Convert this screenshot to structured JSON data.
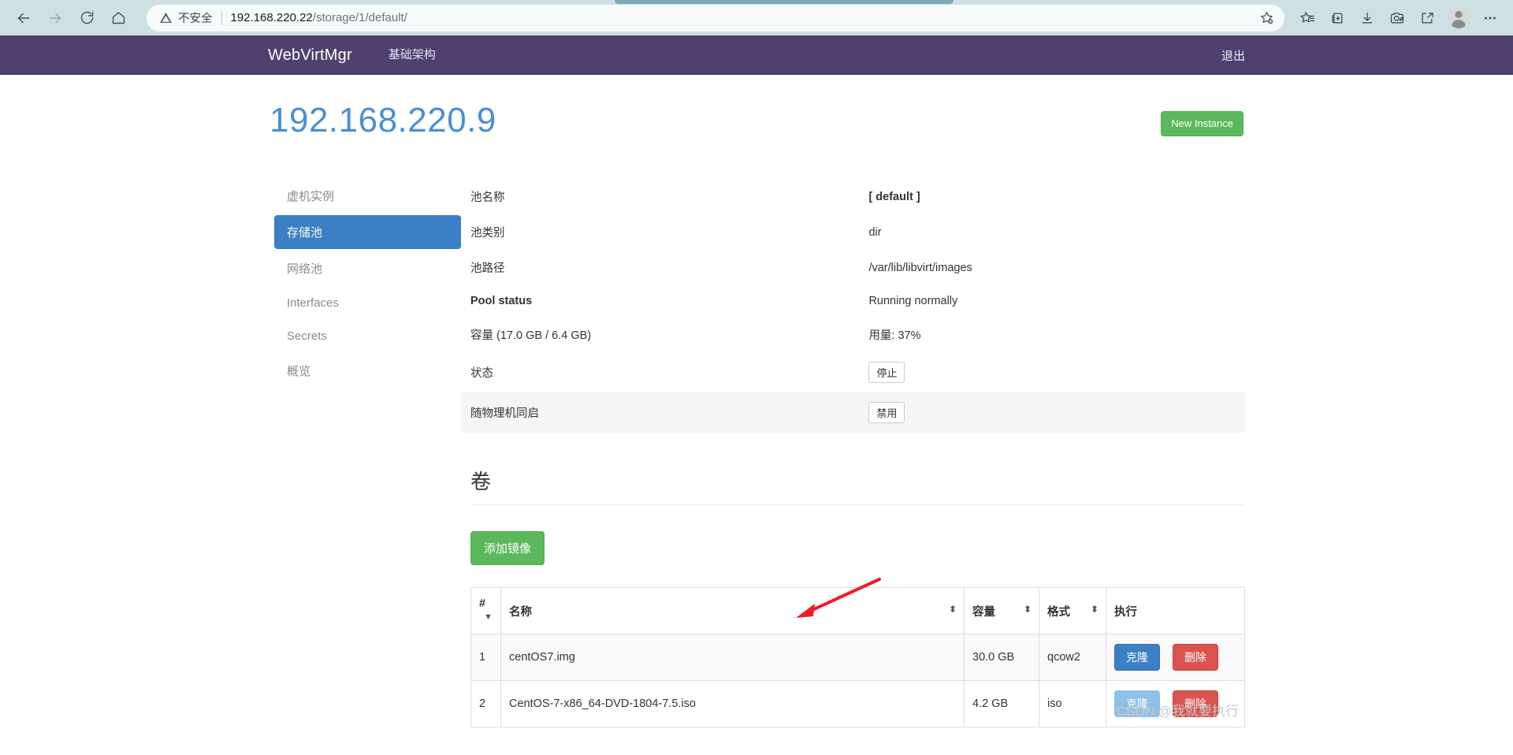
{
  "browser": {
    "back_icon": "back-arrow-icon",
    "forward_icon": "forward-arrow-icon",
    "reload_icon": "reload-icon",
    "home_icon": "home-icon",
    "security_label": "不安全",
    "url_host": "192.168.220.22",
    "url_path": "/storage/1/default/",
    "url_full": "192.168.220.22/storage/1/default/",
    "toolbar_icons": [
      "add-favorite-icon",
      "favorites-list-icon",
      "collections-icon",
      "downloads-icon",
      "web-capture-icon",
      "share-icon",
      "profile-avatar-icon",
      "more-options-icon"
    ]
  },
  "navbar": {
    "brand": "WebVirtMgr",
    "links": [
      {
        "label": "基础架构",
        "name": "nav-link-infrastructure"
      }
    ],
    "logout": "退出",
    "bg_color": "#4f406f"
  },
  "page": {
    "title": "192.168.220.9",
    "title_color": "#4a8fd4",
    "new_instance_label": "New Instance",
    "new_instance_color": "#5cb85c"
  },
  "sidebar": {
    "items": [
      {
        "label": "虚机实例",
        "name": "sidebar-item-instances",
        "active": false
      },
      {
        "label": "存储池",
        "name": "sidebar-item-storages",
        "active": true
      },
      {
        "label": "网络池",
        "name": "sidebar-item-networks",
        "active": false
      },
      {
        "label": "Interfaces",
        "name": "sidebar-item-interfaces",
        "active": false
      },
      {
        "label": "Secrets",
        "name": "sidebar-item-secrets",
        "active": false
      },
      {
        "label": "概览",
        "name": "sidebar-item-overview",
        "active": false
      }
    ],
    "active_color": "#3b7fc4"
  },
  "pool_detail": {
    "rows": [
      {
        "key": "池名称",
        "value": "[ default ]",
        "bold_value": true
      },
      {
        "key": "池类别",
        "value": "dir",
        "bold_value": false
      },
      {
        "key": "池路径",
        "value": "/var/lib/libvirt/images",
        "bold_value": false
      },
      {
        "key": "Pool status",
        "value": "Running normally",
        "bold_value": false,
        "bold_key": true
      },
      {
        "key": "容量 (17.0 GB / 6.4 GB)",
        "value": "用量: 37%",
        "bold_value": false
      },
      {
        "key": "状态",
        "value": "停止",
        "is_button": true
      },
      {
        "key": "随物理机同启",
        "value": "禁用",
        "is_button": true,
        "striped": true
      }
    ]
  },
  "volumes_section": {
    "title": "卷",
    "add_image_label": "添加镜像",
    "columns": [
      {
        "label": "#",
        "sort": "desc"
      },
      {
        "label": "名称",
        "sort": "both"
      },
      {
        "label": "容量",
        "sort": "both"
      },
      {
        "label": "格式",
        "sort": "both"
      },
      {
        "label": "执行",
        "sort": "none"
      }
    ],
    "rows": [
      {
        "index": "1",
        "name": "centOS7.img",
        "size": "30.0 GB",
        "format": "qcow2",
        "clone_label": "克隆",
        "clone_disabled": false,
        "delete_label": "删除"
      },
      {
        "index": "2",
        "name": "CentOS-7-x86_64-DVD-1804-7.5.iso",
        "size": "4.2 GB",
        "format": "iso",
        "clone_label": "克隆",
        "clone_disabled": true,
        "delete_label": "删除"
      }
    ]
  },
  "watermark": "CSDN @我就要执行"
}
